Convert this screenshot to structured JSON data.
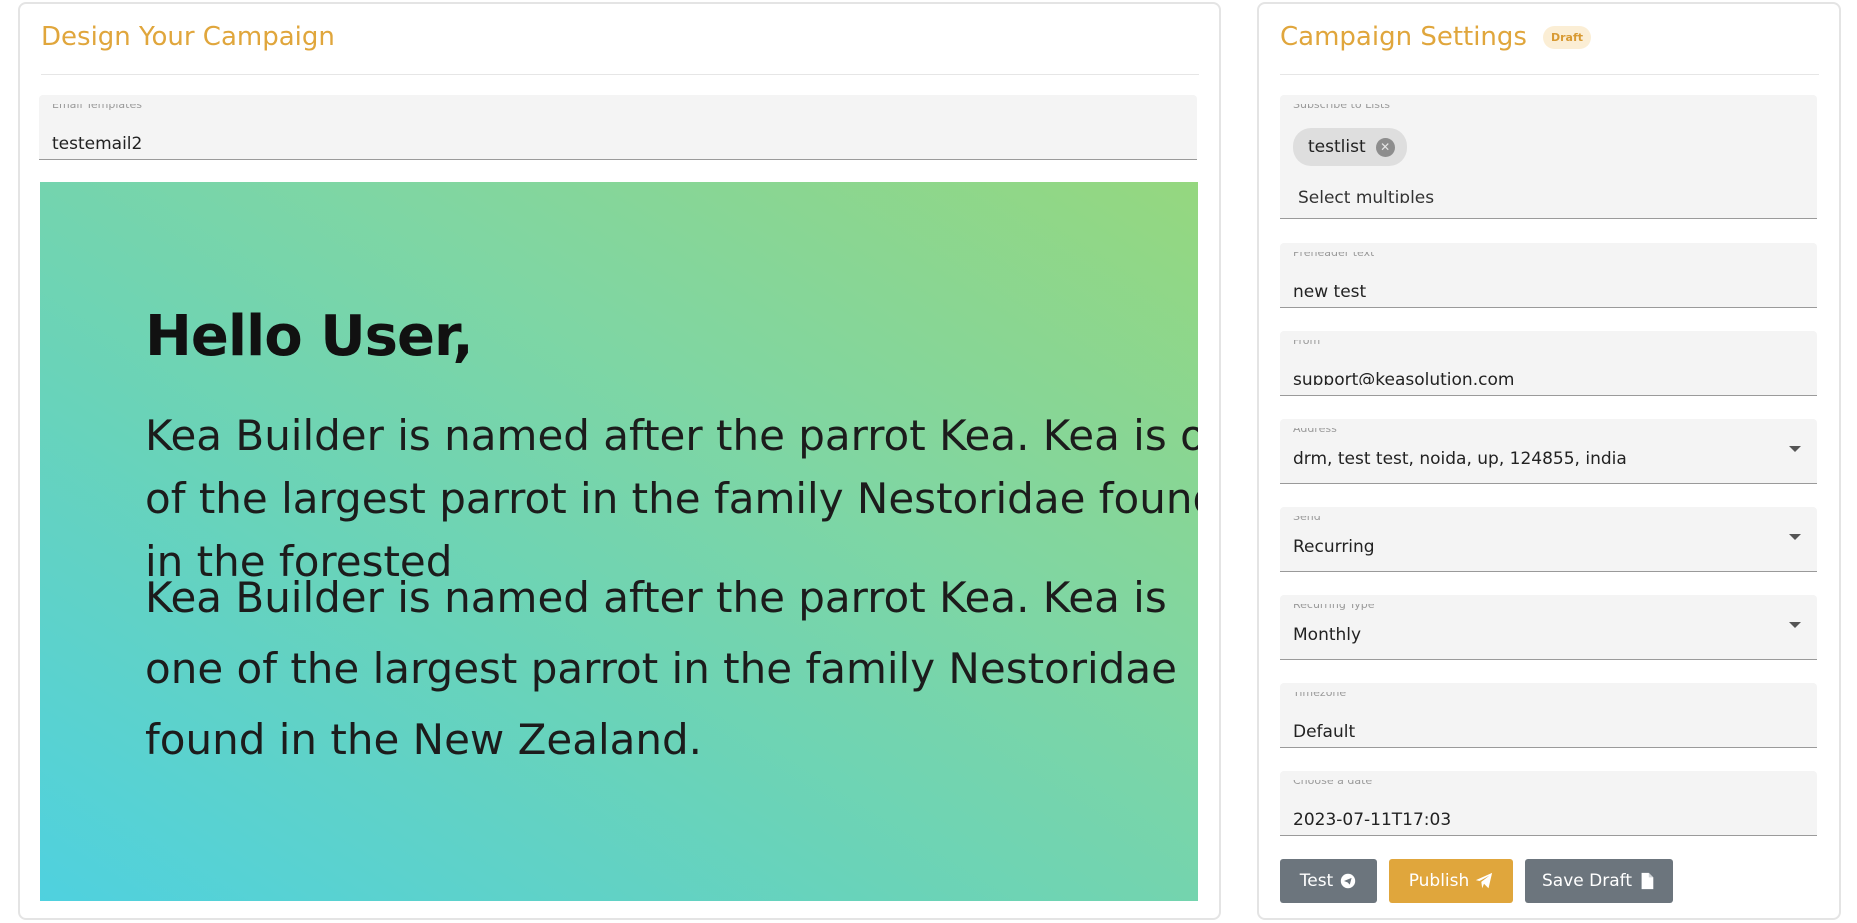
{
  "design_panel": {
    "title": "Design Your Campaign",
    "template_field": {
      "label": "Email Templates",
      "value": "testemail2"
    },
    "preview": {
      "greeting": "Hello User,",
      "paragraph_1": "Kea Builder is named after the parrot Kea. Kea is one of the largest parrot in the family Nestoridae found in the forested",
      "paragraph_2": "Kea Builder is named after the parrot Kea. Kea is one of the largest parrot in the family Nestoridae found in the New Zealand."
    }
  },
  "settings_panel": {
    "title": "Campaign Settings",
    "badge": "Draft",
    "lists": {
      "label": "Subscribe to Lists",
      "chips": [
        "testlist"
      ],
      "placeholder": "Select multiples"
    },
    "preheader": {
      "label": "Preheader text",
      "value": "new test"
    },
    "from": {
      "label": "From",
      "value": "support@keasolution.com"
    },
    "address": {
      "label": "Address",
      "value": "drm, test test, noida, up, 124855, india"
    },
    "send": {
      "label": "Send",
      "value": "Recurring"
    },
    "recurring_type": {
      "label": "Recurring Type",
      "value": "Monthly"
    },
    "timezone": {
      "label": "Timezone",
      "value": "Default"
    },
    "date": {
      "label": "Choose a date",
      "value": "2023-07-11T17:03"
    },
    "buttons": {
      "test": "Test",
      "publish": "Publish",
      "save_draft": "Save Draft"
    }
  },
  "colors": {
    "accent": "#e0a63c",
    "button_gray": "#6c757d",
    "badge_bg": "#fbeed5"
  }
}
